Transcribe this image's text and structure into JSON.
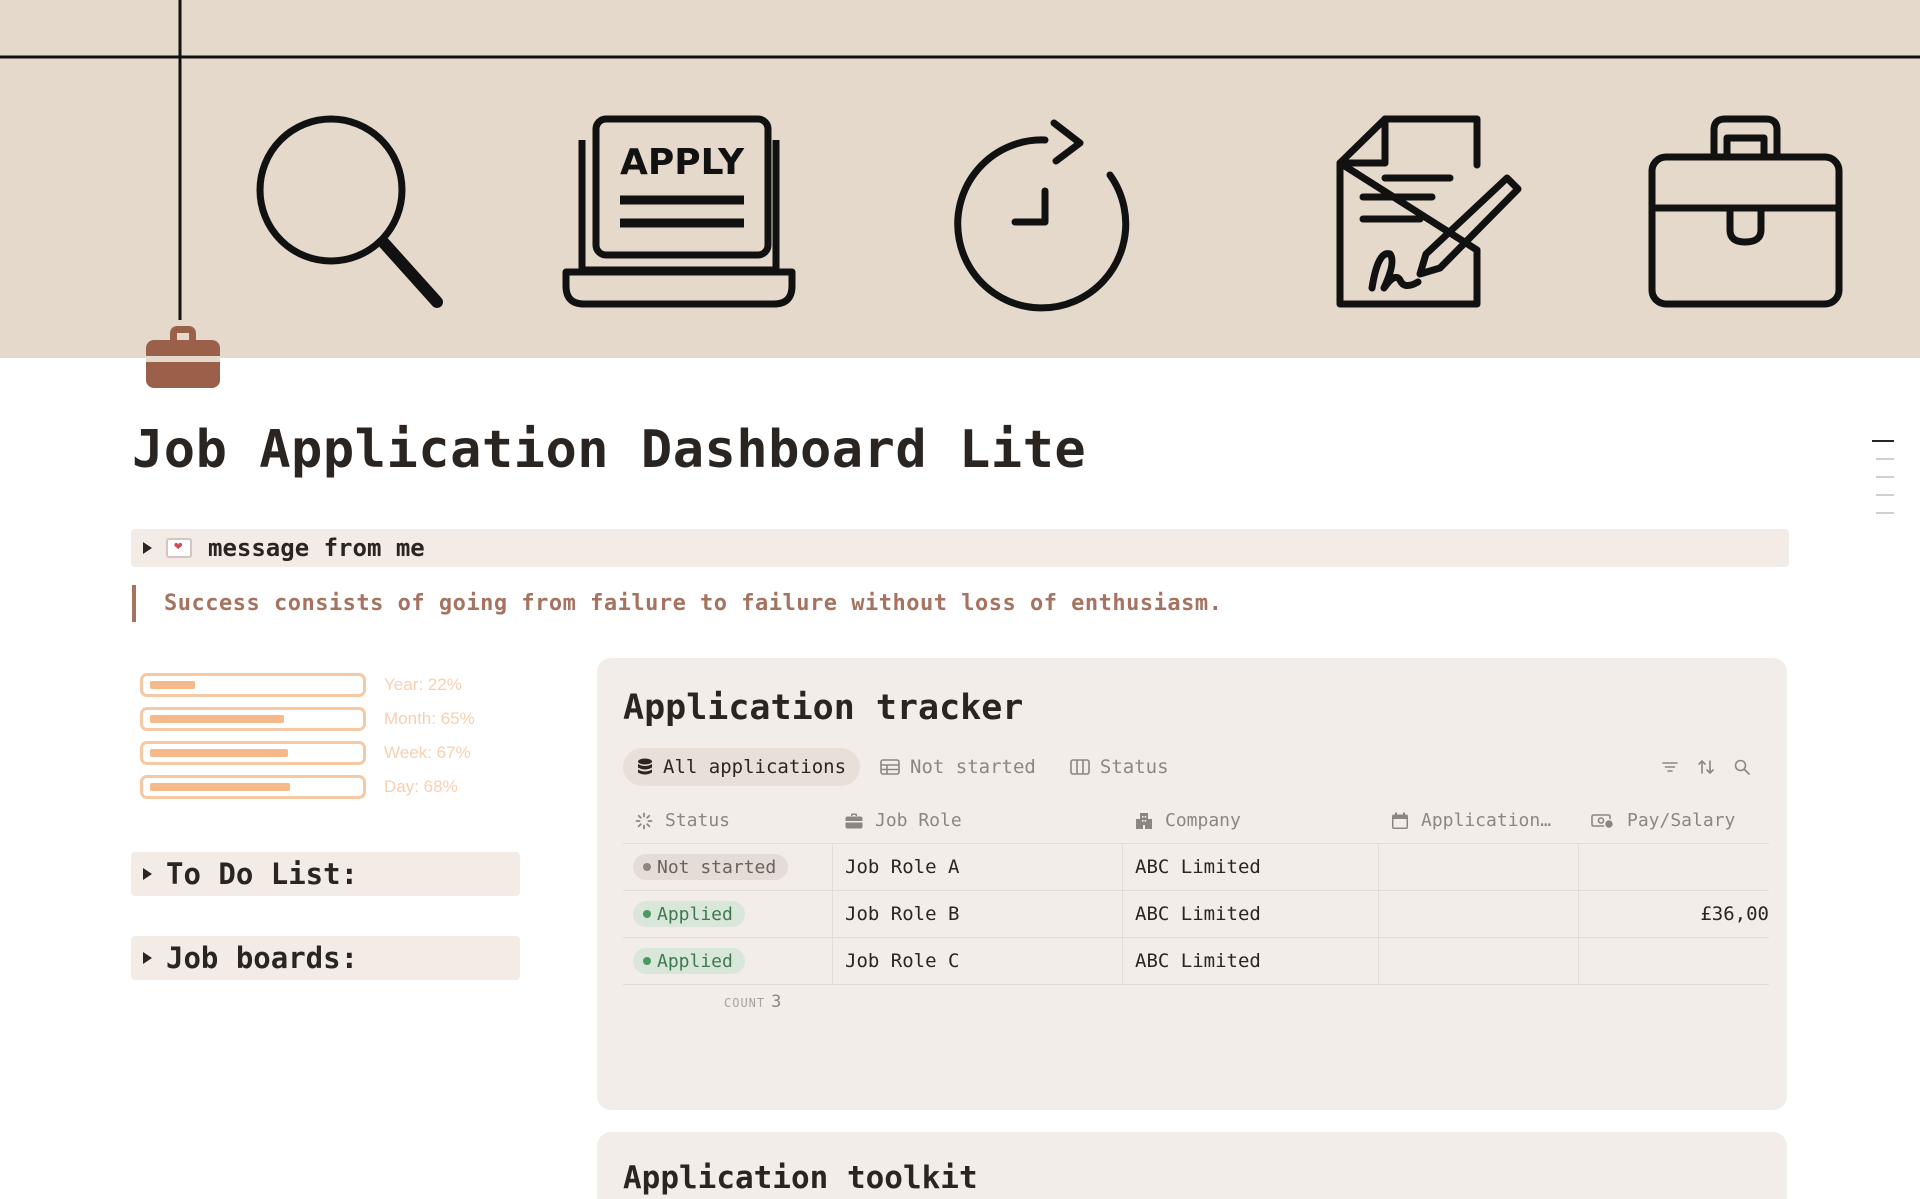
{
  "page": {
    "title": "Job Application Dashboard Lite",
    "page_icon": "briefcase-icon"
  },
  "cover": {
    "icons": [
      "search-icon",
      "apply-laptop-icon",
      "clock-refresh-icon",
      "signed-contract-icon",
      "briefcase-icon"
    ],
    "apply_text": "APPLY"
  },
  "message_toggle": {
    "emoji": "love-letter-icon",
    "label": "message from me"
  },
  "quote": "Success consists of going from failure to failure without loss of enthusiasm.",
  "progress": [
    {
      "label": "Year: 22%",
      "value": 0.22
    },
    {
      "label": "Month: 65%",
      "value": 0.65
    },
    {
      "label": "Week: 67%",
      "value": 0.67
    },
    {
      "label": "Day: 68%",
      "value": 0.68
    }
  ],
  "toggles": {
    "todo": "To Do List:",
    "job_boards": "Job boards:"
  },
  "tracker": {
    "title": "Application tracker",
    "views": [
      {
        "label": "All applications",
        "icon": "database-icon",
        "active": true
      },
      {
        "label": "Not started",
        "icon": "table-icon",
        "active": false
      },
      {
        "label": "Status",
        "icon": "board-icon",
        "active": false
      }
    ],
    "columns": [
      {
        "label": "Status",
        "icon": "status-icon"
      },
      {
        "label": "Job Role",
        "icon": "briefcase-icon"
      },
      {
        "label": "Company",
        "icon": "building-icon"
      },
      {
        "label": "Application…",
        "icon": "calendar-icon"
      },
      {
        "label": "Pay/Salary",
        "icon": "money-icon"
      }
    ],
    "rows": [
      {
        "status": "Not started",
        "status_type": "notstarted",
        "role": "Job Role A",
        "company": "ABC Limited",
        "date": "",
        "pay": ""
      },
      {
        "status": "Applied",
        "status_type": "applied",
        "role": "Job Role B",
        "company": "ABC Limited",
        "date": "",
        "pay": "£36,00"
      },
      {
        "status": "Applied",
        "status_type": "applied",
        "role": "Job Role C",
        "company": "ABC Limited",
        "date": "",
        "pay": ""
      }
    ],
    "count_label": "COUNT",
    "count_value": "3"
  },
  "toolkit": {
    "title": "Application toolkit"
  },
  "colors": {
    "cover_bg": "#e5d9cb",
    "accent": "#a5735f",
    "card_bg": "#f3ede9",
    "applied": "#3d7a4d",
    "progress": "#f6b98a"
  }
}
